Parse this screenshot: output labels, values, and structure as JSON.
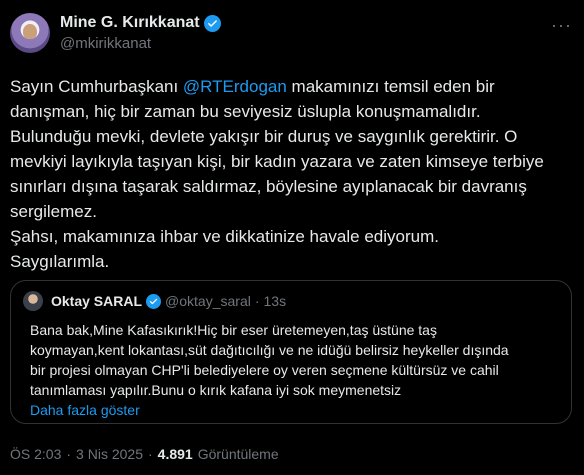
{
  "author": {
    "display_name": "Mine G. Kırıkkanat",
    "handle": "@mkirikkanat"
  },
  "more_icon": "more-horizontal-icon",
  "tweet": {
    "line1_pre": "Sayın Cumhurbaşkanı ",
    "mention": "@RTErdogan",
    "line1_post": " makamınızı temsil eden bir",
    "body": "danışman, hiç bir zaman bu seviyesiz üslupla konuşmamalıdır.\nBulunduğu mevki, devlete yakışır bir duruş ve saygınlık gerektirir. O\nmevkiyi layıkıyla taşıyan kişi, bir kadın yazara ve zaten kimseye terbiye\nsınırları dışına taşarak saldırmaz, böylesine ayıplanacak bir davranış\nsergilemez.\nŞahsı, makamınıza ihbar ve dikkatinize havale ediyorum.\nSaygılarımla."
  },
  "quote": {
    "display_name": "Oktay SARAL",
    "handle": "@oktay_saral",
    "separator": "·",
    "time": "13s",
    "text": "Bana bak,Mine Kafasıkırık!Hiç bir eser üretemeyen,taş üstüne taş\nkoymayan,kent lokantası,süt dağıtıcılığı ve ne idüğü belirsiz heykeller dışında\nbir projesi olmayan CHP'li belediyelere oy veren seçmene kültürsüz ve cahil\ntanımlaması yapılır.Bunu o kırık kafana iyi sok meymenetsiz",
    "show_more": "Daha fazla göster"
  },
  "footer": {
    "time": "ÖS 2:03",
    "sep1": "·",
    "date": "3 Nis 2025",
    "sep2": "·",
    "views": "4.891",
    "views_label": "Görüntüleme"
  },
  "colors": {
    "background": "#000000",
    "text": "#e7e9ea",
    "muted": "#71767b",
    "link": "#1d9bf0",
    "border": "#2f3336"
  }
}
